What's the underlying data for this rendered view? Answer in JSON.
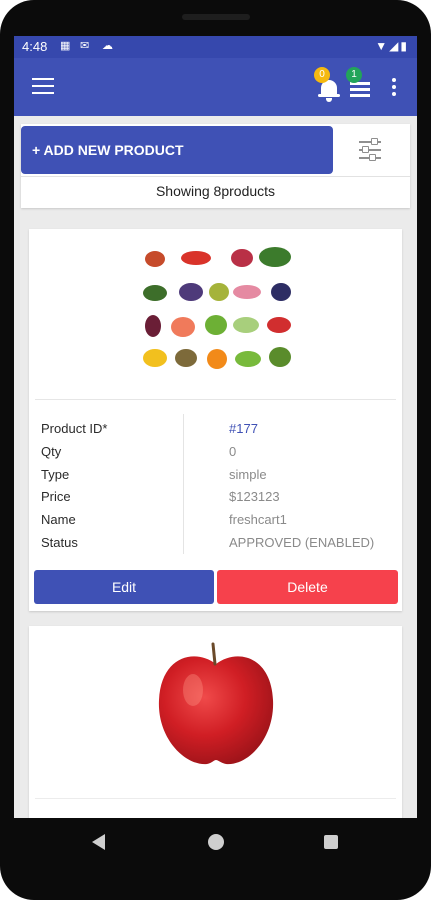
{
  "status_bar": {
    "time": "4:48",
    "icons_left": [
      "calendar-icon",
      "mail-icon",
      "cloud-icon"
    ],
    "icons_right": [
      "wifi-icon",
      "signal-icon",
      "battery-icon"
    ]
  },
  "app_bar": {
    "notification_count": "0",
    "list_count": "1"
  },
  "toolbar": {
    "add_label": "+ ADD NEW PRODUCT",
    "showing_text": "Showing 8products"
  },
  "products": [
    {
      "image": "fruit-collage",
      "fields": [
        {
          "label": "Product ID*",
          "value": "#177"
        },
        {
          "label": "Qty",
          "value": "0"
        },
        {
          "label": "Type",
          "value": "simple"
        },
        {
          "label": "Price",
          "value": "$123123"
        },
        {
          "label": "Name",
          "value": "freshcart1"
        },
        {
          "label": "Status",
          "value": "APPROVED (ENABLED)"
        }
      ],
      "edit_label": "Edit",
      "delete_label": "Delete"
    },
    {
      "image": "red-apple"
    }
  ],
  "colors": {
    "primary": "#3f51b5",
    "status_bar": "#3648ad",
    "delete": "#f6414c",
    "badge_notif": "#f5b90f",
    "badge_list": "#22a45a",
    "link": "#3f51b5"
  }
}
